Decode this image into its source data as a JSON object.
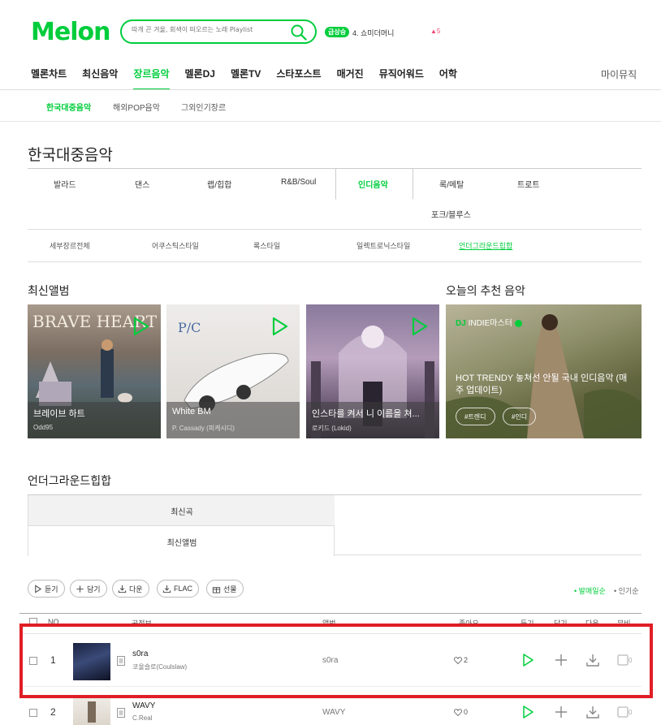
{
  "header": {
    "logo": "Melon",
    "search_placeholder": "따개 끈 겨울, 회색이 떠오르는 노래 Playlist",
    "rank_badge": "급상승",
    "rank_item": "4. 쇼미더머니",
    "rank_change": "▲5"
  },
  "gnb": {
    "items": [
      "멜론차트",
      "최신음악",
      "장르음악",
      "멜론DJ",
      "멜론TV",
      "스타포스트",
      "매거진",
      "뮤직어워드",
      "어학"
    ],
    "active": "장르음악",
    "my_music": "마이뮤직"
  },
  "sub_gnb": {
    "items": [
      "한국대중음악",
      "해외POP음악",
      "그외인기장르"
    ],
    "active": "한국대중음악"
  },
  "page_title": "한국대중음악",
  "genres": {
    "items": [
      "발라드",
      "댄스",
      "랩/힙합",
      "R&B/Soul",
      "인디음악",
      "록/메탈",
      "트로트",
      "포크/블루스"
    ],
    "active": "인디음악"
  },
  "detail_genres": {
    "items": [
      "세부장르전체",
      "어쿠스틱스타일",
      "록스타일",
      "일렉트로닉스타일",
      "언더그라운드힙합"
    ],
    "active": "언더그라운드힙합"
  },
  "new_albums": {
    "title": "최신앨범",
    "items": [
      {
        "title": "브레이브 하트",
        "artist": "Odd95",
        "art_text": "BRAVE HEART"
      },
      {
        "title": "White BM",
        "artist": "P. Cassady (피캐시디)",
        "art_text": "P/C"
      },
      {
        "title": "인스타를 켜서 니 이름을 쳐...",
        "artist": "로키드 (Lokid)",
        "art_text": ""
      }
    ]
  },
  "recommend": {
    "title": "오늘의 추천 음악",
    "dj_prefix": "DJ",
    "dj_name": "INDIE마스터",
    "playlist_title": "HOT TRENDY 놓쳐선 안될 국내 인디음악 (매주 업데이트)",
    "tags": [
      "#트렌디",
      "#인디"
    ]
  },
  "chart": {
    "title": "언더그라운드힙합",
    "tabs": [
      "최신곡",
      "최신앨범"
    ],
    "active_tab": "최신곡"
  },
  "actions": {
    "buttons": [
      "듣기",
      "담기",
      "다운",
      "FLAC",
      "선물"
    ],
    "sort": [
      "발매일순",
      "인기순"
    ],
    "active_sort": "발매일순"
  },
  "table": {
    "headers": [
      "NO",
      "곡정보",
      "앨범",
      "좋아요",
      "듣기",
      "담기",
      "다운",
      "뮤비"
    ],
    "rows": [
      {
        "no": "1",
        "song": "s0ra",
        "artist": "코울슬로(Coulslaw)",
        "album": "s0ra",
        "likes": "2",
        "mv_count": "0"
      },
      {
        "no": "2",
        "song": "WAVY",
        "artist": "C.Real",
        "album": "WAVY",
        "likes": "0",
        "mv_count": "0"
      }
    ]
  },
  "colors": {
    "accent": "#00cd3c",
    "highlight": "#e01e25"
  }
}
